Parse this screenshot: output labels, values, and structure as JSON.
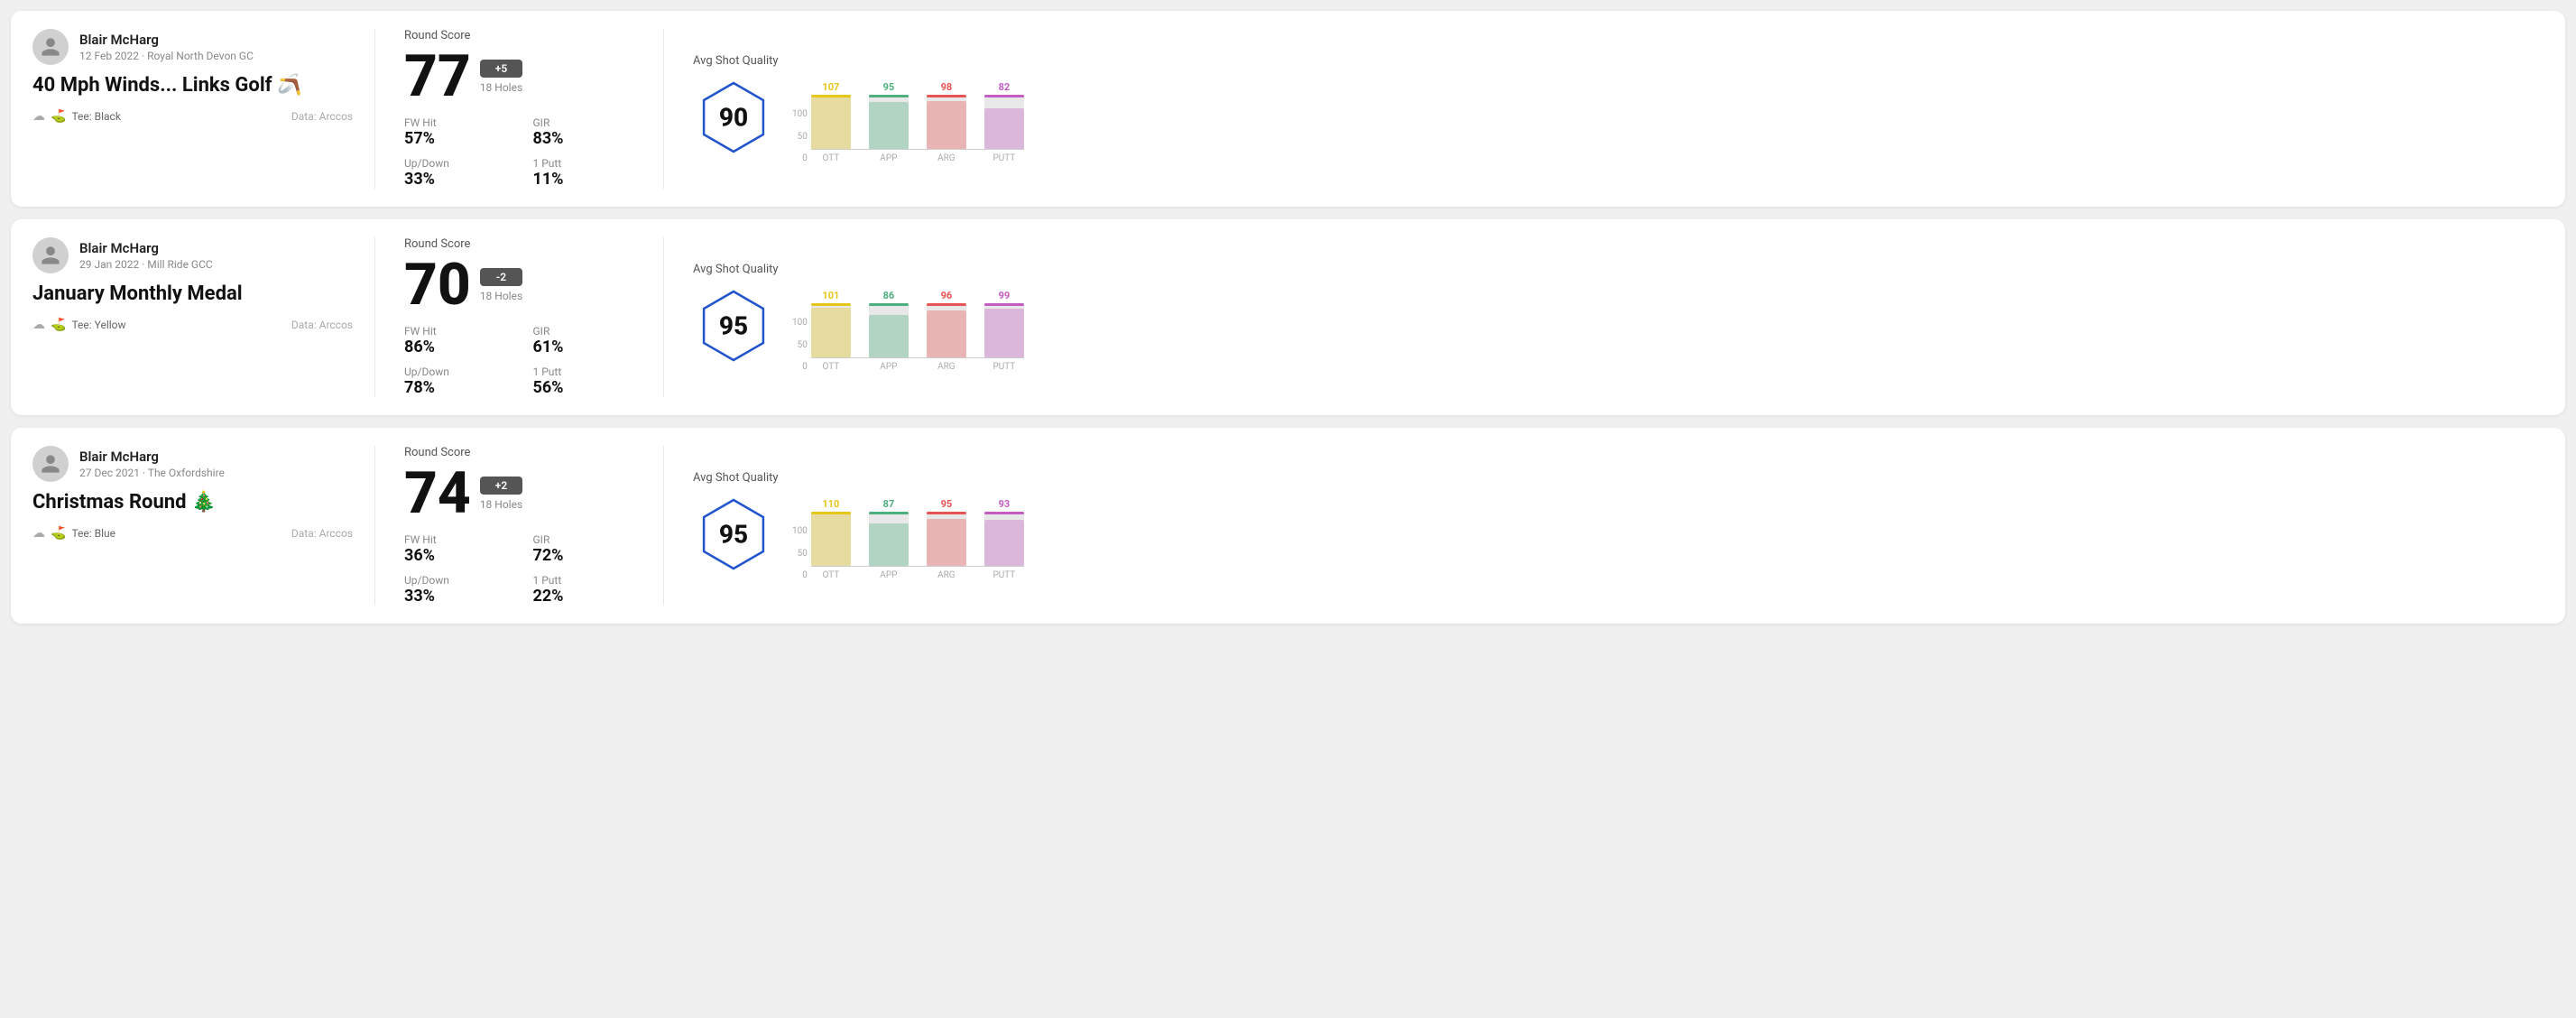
{
  "rounds": [
    {
      "id": "round1",
      "user": {
        "name": "Blair McHarg",
        "meta": "12 Feb 2022 · Royal North Devon GC"
      },
      "title": "40 Mph Winds... Links Golf 🪃",
      "tee": "Black",
      "data_source": "Data: Arccos",
      "score": "77",
      "score_diff": "+5",
      "holes": "18 Holes",
      "fw_hit": "57%",
      "gir": "83%",
      "up_down": "33%",
      "one_putt": "11%",
      "avg_shot_quality": "90",
      "bar_data": [
        {
          "label": "OTT",
          "value": 107,
          "color": "#e6c619"
        },
        {
          "label": "APP",
          "value": 95,
          "color": "#4caf7d"
        },
        {
          "label": "ARG",
          "value": 98,
          "color": "#e85454"
        },
        {
          "label": "PUTT",
          "value": 82,
          "color": "#c45cc4"
        }
      ]
    },
    {
      "id": "round2",
      "user": {
        "name": "Blair McHarg",
        "meta": "29 Jan 2022 · Mill Ride GCC"
      },
      "title": "January Monthly Medal",
      "tee": "Yellow",
      "data_source": "Data: Arccos",
      "score": "70",
      "score_diff": "-2",
      "holes": "18 Holes",
      "fw_hit": "86%",
      "gir": "61%",
      "up_down": "78%",
      "one_putt": "56%",
      "avg_shot_quality": "95",
      "bar_data": [
        {
          "label": "OTT",
          "value": 101,
          "color": "#e6c619"
        },
        {
          "label": "APP",
          "value": 86,
          "color": "#4caf7d"
        },
        {
          "label": "ARG",
          "value": 96,
          "color": "#e85454"
        },
        {
          "label": "PUTT",
          "value": 99,
          "color": "#c45cc4"
        }
      ]
    },
    {
      "id": "round3",
      "user": {
        "name": "Blair McHarg",
        "meta": "27 Dec 2021 · The Oxfordshire"
      },
      "title": "Christmas Round 🎄",
      "tee": "Blue",
      "data_source": "Data: Arccos",
      "score": "74",
      "score_diff": "+2",
      "holes": "18 Holes",
      "fw_hit": "36%",
      "gir": "72%",
      "up_down": "33%",
      "one_putt": "22%",
      "avg_shot_quality": "95",
      "bar_data": [
        {
          "label": "OTT",
          "value": 110,
          "color": "#e6c619"
        },
        {
          "label": "APP",
          "value": 87,
          "color": "#4caf7d"
        },
        {
          "label": "ARG",
          "value": 95,
          "color": "#e85454"
        },
        {
          "label": "PUTT",
          "value": 93,
          "color": "#c45cc4"
        }
      ]
    }
  ],
  "chart_y_labels": [
    "100",
    "50",
    "0"
  ],
  "stat_labels": {
    "fw_hit": "FW Hit",
    "gir": "GIR",
    "up_down": "Up/Down",
    "one_putt": "1 Putt"
  }
}
